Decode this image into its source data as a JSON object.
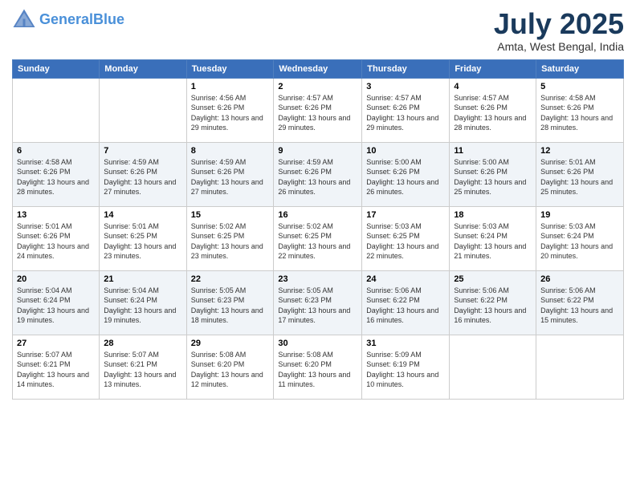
{
  "header": {
    "logo_line1": "General",
    "logo_line2": "Blue",
    "month_year": "July 2025",
    "location": "Amta, West Bengal, India"
  },
  "weekdays": [
    "Sunday",
    "Monday",
    "Tuesday",
    "Wednesday",
    "Thursday",
    "Friday",
    "Saturday"
  ],
  "weeks": [
    [
      {
        "day": "",
        "sunrise": "",
        "sunset": "",
        "daylight": ""
      },
      {
        "day": "",
        "sunrise": "",
        "sunset": "",
        "daylight": ""
      },
      {
        "day": "1",
        "sunrise": "Sunrise: 4:56 AM",
        "sunset": "Sunset: 6:26 PM",
        "daylight": "Daylight: 13 hours and 29 minutes."
      },
      {
        "day": "2",
        "sunrise": "Sunrise: 4:57 AM",
        "sunset": "Sunset: 6:26 PM",
        "daylight": "Daylight: 13 hours and 29 minutes."
      },
      {
        "day": "3",
        "sunrise": "Sunrise: 4:57 AM",
        "sunset": "Sunset: 6:26 PM",
        "daylight": "Daylight: 13 hours and 29 minutes."
      },
      {
        "day": "4",
        "sunrise": "Sunrise: 4:57 AM",
        "sunset": "Sunset: 6:26 PM",
        "daylight": "Daylight: 13 hours and 28 minutes."
      },
      {
        "day": "5",
        "sunrise": "Sunrise: 4:58 AM",
        "sunset": "Sunset: 6:26 PM",
        "daylight": "Daylight: 13 hours and 28 minutes."
      }
    ],
    [
      {
        "day": "6",
        "sunrise": "Sunrise: 4:58 AM",
        "sunset": "Sunset: 6:26 PM",
        "daylight": "Daylight: 13 hours and 28 minutes."
      },
      {
        "day": "7",
        "sunrise": "Sunrise: 4:59 AM",
        "sunset": "Sunset: 6:26 PM",
        "daylight": "Daylight: 13 hours and 27 minutes."
      },
      {
        "day": "8",
        "sunrise": "Sunrise: 4:59 AM",
        "sunset": "Sunset: 6:26 PM",
        "daylight": "Daylight: 13 hours and 27 minutes."
      },
      {
        "day": "9",
        "sunrise": "Sunrise: 4:59 AM",
        "sunset": "Sunset: 6:26 PM",
        "daylight": "Daylight: 13 hours and 26 minutes."
      },
      {
        "day": "10",
        "sunrise": "Sunrise: 5:00 AM",
        "sunset": "Sunset: 6:26 PM",
        "daylight": "Daylight: 13 hours and 26 minutes."
      },
      {
        "day": "11",
        "sunrise": "Sunrise: 5:00 AM",
        "sunset": "Sunset: 6:26 PM",
        "daylight": "Daylight: 13 hours and 25 minutes."
      },
      {
        "day": "12",
        "sunrise": "Sunrise: 5:01 AM",
        "sunset": "Sunset: 6:26 PM",
        "daylight": "Daylight: 13 hours and 25 minutes."
      }
    ],
    [
      {
        "day": "13",
        "sunrise": "Sunrise: 5:01 AM",
        "sunset": "Sunset: 6:26 PM",
        "daylight": "Daylight: 13 hours and 24 minutes."
      },
      {
        "day": "14",
        "sunrise": "Sunrise: 5:01 AM",
        "sunset": "Sunset: 6:25 PM",
        "daylight": "Daylight: 13 hours and 23 minutes."
      },
      {
        "day": "15",
        "sunrise": "Sunrise: 5:02 AM",
        "sunset": "Sunset: 6:25 PM",
        "daylight": "Daylight: 13 hours and 23 minutes."
      },
      {
        "day": "16",
        "sunrise": "Sunrise: 5:02 AM",
        "sunset": "Sunset: 6:25 PM",
        "daylight": "Daylight: 13 hours and 22 minutes."
      },
      {
        "day": "17",
        "sunrise": "Sunrise: 5:03 AM",
        "sunset": "Sunset: 6:25 PM",
        "daylight": "Daylight: 13 hours and 22 minutes."
      },
      {
        "day": "18",
        "sunrise": "Sunrise: 5:03 AM",
        "sunset": "Sunset: 6:24 PM",
        "daylight": "Daylight: 13 hours and 21 minutes."
      },
      {
        "day": "19",
        "sunrise": "Sunrise: 5:03 AM",
        "sunset": "Sunset: 6:24 PM",
        "daylight": "Daylight: 13 hours and 20 minutes."
      }
    ],
    [
      {
        "day": "20",
        "sunrise": "Sunrise: 5:04 AM",
        "sunset": "Sunset: 6:24 PM",
        "daylight": "Daylight: 13 hours and 19 minutes."
      },
      {
        "day": "21",
        "sunrise": "Sunrise: 5:04 AM",
        "sunset": "Sunset: 6:24 PM",
        "daylight": "Daylight: 13 hours and 19 minutes."
      },
      {
        "day": "22",
        "sunrise": "Sunrise: 5:05 AM",
        "sunset": "Sunset: 6:23 PM",
        "daylight": "Daylight: 13 hours and 18 minutes."
      },
      {
        "day": "23",
        "sunrise": "Sunrise: 5:05 AM",
        "sunset": "Sunset: 6:23 PM",
        "daylight": "Daylight: 13 hours and 17 minutes."
      },
      {
        "day": "24",
        "sunrise": "Sunrise: 5:06 AM",
        "sunset": "Sunset: 6:22 PM",
        "daylight": "Daylight: 13 hours and 16 minutes."
      },
      {
        "day": "25",
        "sunrise": "Sunrise: 5:06 AM",
        "sunset": "Sunset: 6:22 PM",
        "daylight": "Daylight: 13 hours and 16 minutes."
      },
      {
        "day": "26",
        "sunrise": "Sunrise: 5:06 AM",
        "sunset": "Sunset: 6:22 PM",
        "daylight": "Daylight: 13 hours and 15 minutes."
      }
    ],
    [
      {
        "day": "27",
        "sunrise": "Sunrise: 5:07 AM",
        "sunset": "Sunset: 6:21 PM",
        "daylight": "Daylight: 13 hours and 14 minutes."
      },
      {
        "day": "28",
        "sunrise": "Sunrise: 5:07 AM",
        "sunset": "Sunset: 6:21 PM",
        "daylight": "Daylight: 13 hours and 13 minutes."
      },
      {
        "day": "29",
        "sunrise": "Sunrise: 5:08 AM",
        "sunset": "Sunset: 6:20 PM",
        "daylight": "Daylight: 13 hours and 12 minutes."
      },
      {
        "day": "30",
        "sunrise": "Sunrise: 5:08 AM",
        "sunset": "Sunset: 6:20 PM",
        "daylight": "Daylight: 13 hours and 11 minutes."
      },
      {
        "day": "31",
        "sunrise": "Sunrise: 5:09 AM",
        "sunset": "Sunset: 6:19 PM",
        "daylight": "Daylight: 13 hours and 10 minutes."
      },
      {
        "day": "",
        "sunrise": "",
        "sunset": "",
        "daylight": ""
      },
      {
        "day": "",
        "sunrise": "",
        "sunset": "",
        "daylight": ""
      }
    ]
  ]
}
